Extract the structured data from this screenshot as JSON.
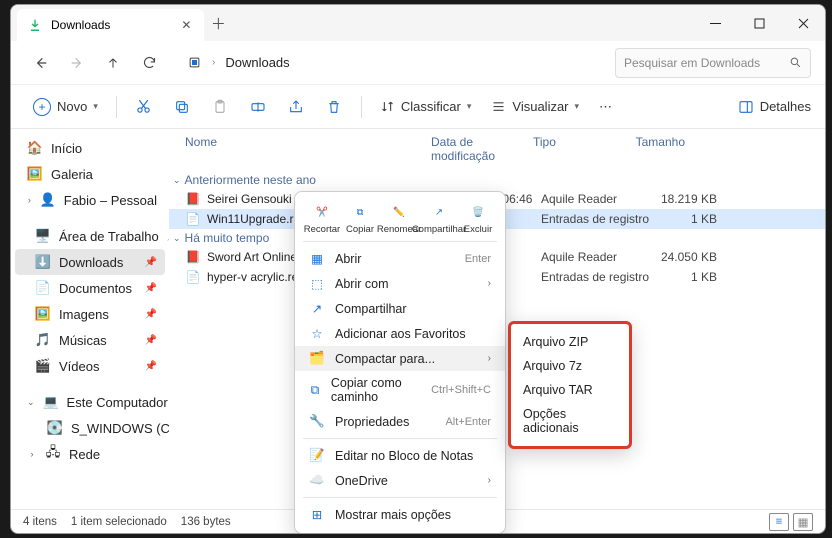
{
  "titlebar": {
    "tab_label": "Downloads"
  },
  "nav": {
    "crumb_label": "Downloads",
    "search_placeholder": "Pesquisar em Downloads"
  },
  "toolbar": {
    "new": "Novo",
    "sort": "Classificar",
    "view": "Visualizar",
    "details": "Detalhes"
  },
  "sidebar": {
    "home": "Início",
    "gallery": "Galeria",
    "personal": "Fabio – Pessoal",
    "desktop": "Área de Trabalho",
    "downloads": "Downloads",
    "documents": "Documentos",
    "images": "Imagens",
    "music": "Músicas",
    "videos": "Vídeos",
    "thispc": "Este Computador",
    "cdrive": "S_WINDOWS (C:)",
    "network": "Rede"
  },
  "columns": {
    "name": "Nome",
    "date": "Data de modificação",
    "type": "Tipo",
    "size": "Tamanho"
  },
  "groups": {
    "g1": "Anteriormente neste ano",
    "g2": "Há muito tempo"
  },
  "files": {
    "f0": {
      "name": "Seirei Gensouki - Spirit Chronicles Vol-24.epub",
      "date": "08/05/2024 06:46",
      "type": "Aquile Reader",
      "size": "18.219 KB"
    },
    "f1": {
      "name": "Win11Upgrade.reg",
      "date": "",
      "type": "Entradas de registro",
      "size": "1 KB"
    },
    "f2": {
      "name": "Sword Art Online Alterna",
      "date": "",
      "type": "Aquile Reader",
      "size": "24.050 KB"
    },
    "f3": {
      "name": "hyper-v acrylic.reg",
      "date": "",
      "type": "Entradas de registro",
      "size": "1 KB"
    }
  },
  "ctx": {
    "cut": "Recortar",
    "copy": "Copiar",
    "rename": "Renomear",
    "share": "Compartilhar",
    "delete": "Excluir",
    "open": "Abrir",
    "open_sc": "Enter",
    "openwith": "Abrir com",
    "share_item": "Compartilhar",
    "favorite": "Adicionar aos Favoritos",
    "compress": "Compactar para...",
    "copypath": "Copiar como caminho",
    "copypath_sc": "Ctrl+Shift+C",
    "props": "Propriedades",
    "props_sc": "Alt+Enter",
    "notepad": "Editar no Bloco de Notas",
    "onedrive": "OneDrive",
    "more": "Mostrar mais opções"
  },
  "submenu": {
    "zip": "Arquivo ZIP",
    "sevenz": "Arquivo 7z",
    "tar": "Arquivo TAR",
    "more": "Opções adicionais"
  },
  "status": {
    "items": "4 itens",
    "selected": "1 item selecionado",
    "bytes": "136 bytes"
  }
}
